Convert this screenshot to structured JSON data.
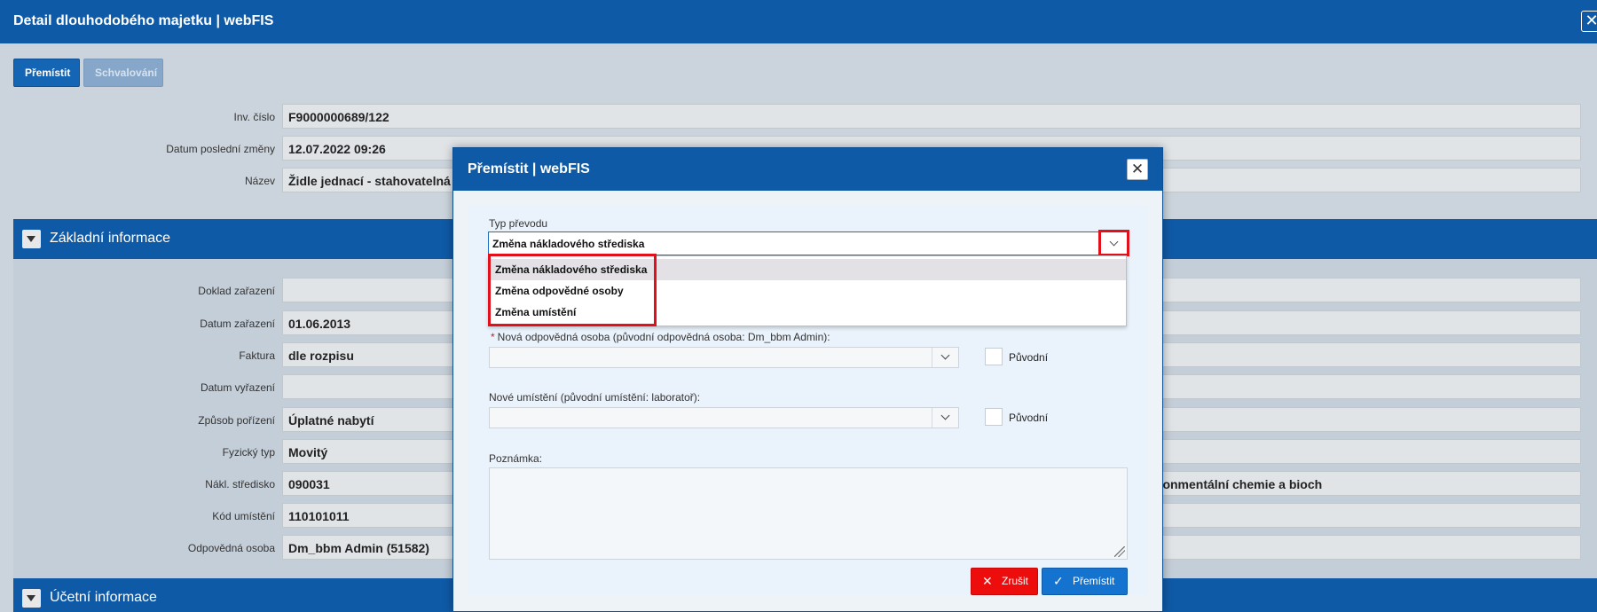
{
  "window": {
    "title": "Detail dlouhodobého majetku | webFIS",
    "close_glyph": "✕"
  },
  "toolbar": {
    "tabs": [
      "Přemístit",
      "Schvalování"
    ]
  },
  "header_fields": [
    {
      "label": "Inv. číslo",
      "value": "F9000000689/122"
    },
    {
      "label": "Datum poslední změny",
      "value": "12.07.2022 09:26"
    },
    {
      "label": "Název",
      "value": "Židle jednací - stahovatelná"
    }
  ],
  "sections": {
    "basic": "Základní informace",
    "accounting": "Účetní informace"
  },
  "basic_fields": [
    {
      "label": "Doklad zařazení",
      "value": ""
    },
    {
      "label": "Datum zařazení",
      "value": "01.06.2013"
    },
    {
      "label": "Faktura",
      "value": "dle rozpisu"
    },
    {
      "label": "Datum vyřazení",
      "value": ""
    },
    {
      "label": "Způsob pořízení",
      "value": "Úplatné nabytí"
    },
    {
      "label": "Fyzický typ",
      "value": "Movitý"
    },
    {
      "label": "Nákl. středisko",
      "value": "090031"
    },
    {
      "label": "Kód umístění",
      "value": "110101011"
    },
    {
      "label": "Odpovědná osoba",
      "value": "Dm_bbm Admin (51582)"
    }
  ],
  "nakl_extension": "ronmentální chemie a bioch",
  "modal": {
    "title": "Přemístit | webFIS",
    "close_glyph": "✕",
    "transfer_type": {
      "label": "Typ převodu",
      "selected": "Změna nákladového střediska",
      "options": [
        "Změna nákladového střediska",
        "Změna odpovědné osoby",
        "Změna umístění"
      ]
    },
    "new_person": {
      "required_mark": "*",
      "label": "Nová odpovědná osoba (původní odpovědná osoba: Dm_bbm Admin):",
      "original_label": "Původní"
    },
    "new_location": {
      "label": "Nové umístění (původní umístění: laboratoř):",
      "original_label": "Původní"
    },
    "note": {
      "label": "Poznámka:"
    },
    "buttons": {
      "cancel": "Zrušit",
      "cancel_icon": "✕",
      "move": "Přemístit",
      "move_icon": "✓"
    }
  },
  "colors": {
    "primary": "#0f5aa6",
    "danger": "#ee0d0d",
    "highlight": "#e1101a"
  }
}
